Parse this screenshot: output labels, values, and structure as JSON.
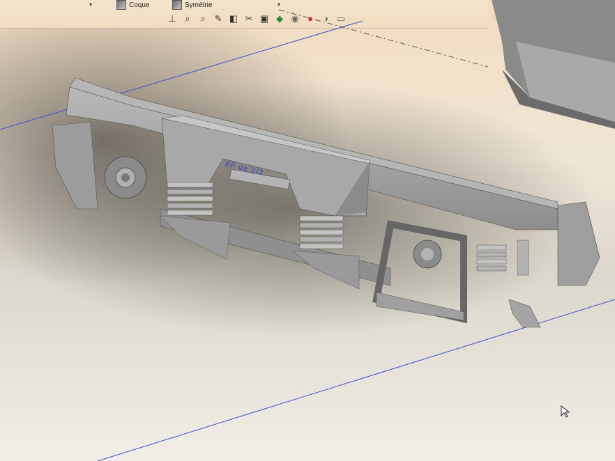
{
  "toolbar": {
    "arrow_left": "▾",
    "coque_label": "Coque",
    "symetrie_label": "Symétrie",
    "arrow_right": "▾",
    "view_icons": [
      {
        "name": "normal-to-icon",
        "glyph": "⊥"
      },
      {
        "name": "zoom-to-fit-icon",
        "glyph": "⌕"
      },
      {
        "name": "zoom-area-icon",
        "glyph": "⌕"
      },
      {
        "name": "previous-view-icon",
        "glyph": "✎"
      },
      {
        "name": "section-view-icon",
        "glyph": "◧"
      },
      {
        "name": "dynamic-annotation-icon",
        "glyph": "✂"
      },
      {
        "name": "view-orientation-icon",
        "glyph": "▣"
      },
      {
        "name": "display-style-icon",
        "glyph": "◆"
      },
      {
        "name": "hide-show-items-icon",
        "glyph": "◉"
      },
      {
        "name": "edit-appearance-icon",
        "glyph": "●"
      },
      {
        "name": "apply-scene-icon",
        "glyph": "◑"
      },
      {
        "name": "view-settings-icon",
        "glyph": "▭"
      }
    ]
  },
  "viewport": {
    "annotation_text": "BF de 2/3"
  },
  "colors": {
    "toolbar_bg": "#f0dcc0",
    "model_gray": "#9a9a9a",
    "axis_blue": "#3b4fd8",
    "annotation_blue": "#3a3fe0"
  }
}
